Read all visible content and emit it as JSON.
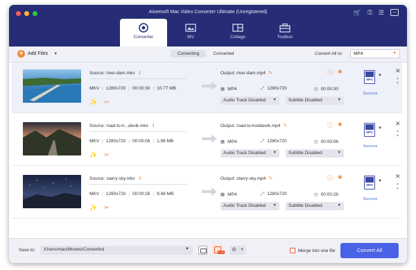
{
  "window": {
    "title": "Aiseesoft Mac Video Converter Ultimate (Unregistered)"
  },
  "top_icons": [
    "cart-icon",
    "key-icon",
    "menu-icon",
    "minimize-icon"
  ],
  "tabs": [
    {
      "label": "Converter",
      "icon": "converter-icon",
      "active": true
    },
    {
      "label": "MV",
      "icon": "mv-icon",
      "active": false
    },
    {
      "label": "Collage",
      "icon": "collage-icon",
      "active": false
    },
    {
      "label": "Toolbox",
      "icon": "toolbox-icon",
      "active": false
    }
  ],
  "toolbar": {
    "add_files": "Add Files",
    "seg_converting": "Converting",
    "seg_converted": "Converted",
    "convert_all_to": "Convert All to:",
    "format": "MP4"
  },
  "files": [
    {
      "source": "Source: river-dam.mkv",
      "container": "MKV",
      "resolution": "1280x720",
      "duration": "00:00:30",
      "size": "10.77 MB",
      "output": "Output: river-dam.mp4",
      "out_format": "MP4",
      "out_resolution": "1280x720",
      "out_duration": "00:00:30",
      "audio": "Audio Track Disabled",
      "subtitle": "Subtitle Disabled",
      "status": "Success",
      "badge": "MP4",
      "selected": true
    },
    {
      "source": "Source: road-to-h...devik.mkv",
      "container": "MKV",
      "resolution": "1280x720",
      "duration": "00:00:06",
      "size": "1.98 MB",
      "output": "Output: road-to-hoddevik.mp4",
      "out_format": "MP4",
      "out_resolution": "1280x720",
      "out_duration": "00:00:06",
      "audio": "Audio Track Disabled",
      "subtitle": "Subtitle Disabled",
      "status": "Success",
      "badge": "MP4",
      "selected": false
    },
    {
      "source": "Source: starry-sky.mkv",
      "container": "MKV",
      "resolution": "1280x720",
      "duration": "00:00:26",
      "size": "9.48 MB",
      "output": "Output: starry-sky.mp4",
      "out_format": "MP4",
      "out_resolution": "1280x720",
      "out_duration": "00:00:26",
      "audio": "Audio Track Disabled",
      "subtitle": "Subtitle Disabled",
      "status": "Success",
      "badge": "MP4",
      "selected": false
    }
  ],
  "footer": {
    "save_to": "Save to:",
    "path": "/Users/mac/Movies/Converted",
    "hw_off": "OFF",
    "merge": "Merge into one file",
    "convert_all": "Convert All"
  },
  "colors": {
    "header": "#262c76",
    "accent": "#f08a3a",
    "primary": "#4a62e6",
    "success": "#3b6fc7"
  }
}
